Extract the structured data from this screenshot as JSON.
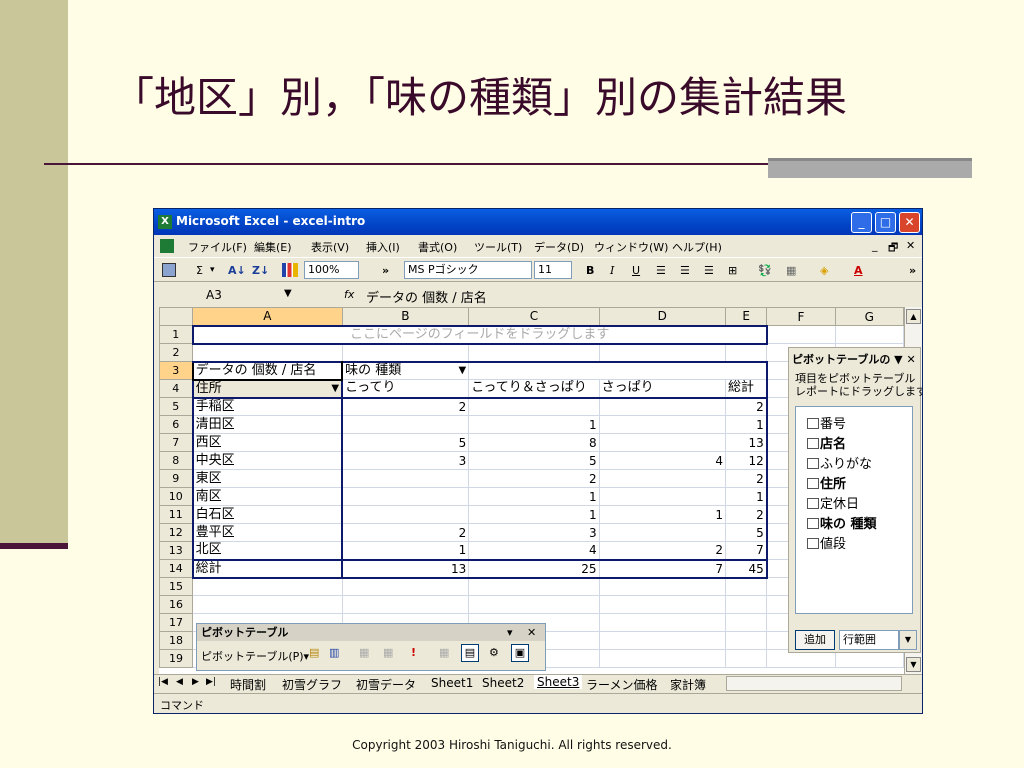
{
  "slide": {
    "title": "「地区」別，「味の種類」別の集計結果",
    "copyright": "Copyright 2003 Hiroshi Taniguchi. All rights reserved."
  },
  "window": {
    "title": "Microsoft Excel - excel-intro",
    "controls": {
      "minimize": "_",
      "maximize": "□",
      "close": "✕"
    }
  },
  "menu": [
    "ファイル(F)",
    "編集(E)",
    "表示(V)",
    "挿入(I)",
    "書式(O)",
    "ツール(T)",
    "データ(D)",
    "ウィンドウ(W)",
    "ヘルプ(H)"
  ],
  "menu_right": {
    "minimize": "_",
    "restore": "🗗",
    "close": "✕"
  },
  "toolbar": {
    "sum": "Σ",
    "zoom": "100%",
    "font": "MS Pゴシック",
    "size": "11",
    "bold": "B",
    "italic": "I",
    "underline": "U",
    "more": "»"
  },
  "formula": {
    "cell_ref": "A3",
    "fx": "fx",
    "content": "データの 個数 / 店名"
  },
  "columns": [
    "A",
    "B",
    "C",
    "D",
    "E",
    "F",
    "G"
  ],
  "rows": [
    "1",
    "2",
    "3",
    "4",
    "5",
    "6",
    "7",
    "8",
    "9",
    "10",
    "11",
    "12",
    "13",
    "14",
    "15",
    "16",
    "17",
    "18",
    "19"
  ],
  "pivot": {
    "page_drop_hint": "ここにページのフィールドをドラッグします",
    "data_label": "データの 個数 / 店名",
    "col_field": "味の 種類",
    "row_field": "住所",
    "col_items": [
      "こってり",
      "こってり＆さっぱり",
      "さっぱり",
      "総計"
    ],
    "body": [
      {
        "label": "手稲区",
        "v": [
          "2",
          "",
          "",
          "2"
        ]
      },
      {
        "label": "清田区",
        "v": [
          "",
          "1",
          "",
          "1"
        ]
      },
      {
        "label": "西区",
        "v": [
          "5",
          "8",
          "",
          "13"
        ]
      },
      {
        "label": "中央区",
        "v": [
          "3",
          "5",
          "4",
          "12"
        ]
      },
      {
        "label": "東区",
        "v": [
          "",
          "2",
          "",
          "2"
        ]
      },
      {
        "label": "南区",
        "v": [
          "",
          "1",
          "",
          "1"
        ]
      },
      {
        "label": "白石区",
        "v": [
          "",
          "1",
          "1",
          "2"
        ]
      },
      {
        "label": "豊平区",
        "v": [
          "2",
          "3",
          "",
          "5"
        ]
      },
      {
        "label": "北区",
        "v": [
          "1",
          "4",
          "2",
          "7"
        ]
      },
      {
        "label": "総計",
        "v": [
          "13",
          "25",
          "7",
          "45"
        ]
      }
    ]
  },
  "field_panel": {
    "title": "ピボットテーブルの ▼ ✕",
    "desc1": "項目をピボットテーブル",
    "desc2": "レポートにドラッグします",
    "fields": [
      "番号",
      "店名",
      "ふりがな",
      "住所",
      "定休日",
      "味の 種類",
      "値段"
    ],
    "add_button": "追加",
    "area_select": "行範囲"
  },
  "pivot_toolbar": {
    "title": "ピボットテーブル",
    "menu": "ピボットテーブル(P)▾",
    "close": "✕",
    "dropdown": "▾"
  },
  "sheet_tabs": [
    "時間割",
    "初雪グラフ",
    "初雪データ",
    "Sheet1",
    "Sheet2",
    "Sheet3",
    "ラーメン価格",
    "家計簿"
  ],
  "active_sheet": "Sheet3",
  "status": "コマンド"
}
